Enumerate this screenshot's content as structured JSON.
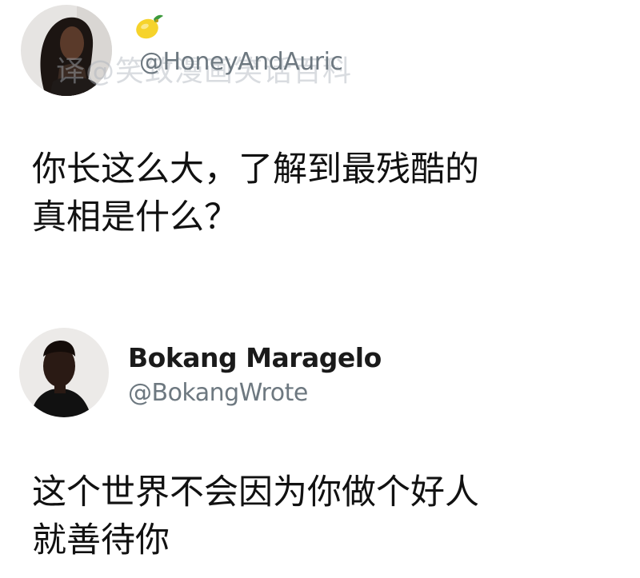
{
  "posts": [
    {
      "handle": "@HoneyAndAuric",
      "watermark": "译@笑致漫画笑话百科",
      "text": "你长这么大，了解到最残酷的\n真相是什么？",
      "avatar_icon": "woman-portrait-avatar",
      "emoji_icon": "lemon-emoji-icon"
    },
    {
      "display_name": "Bokang Maragelo",
      "handle": "@BokangWrote",
      "text": "这个世界不会因为你做个好人\n就善待你",
      "avatar_icon": "man-portrait-avatar"
    }
  ],
  "colors": {
    "text": "#111111",
    "handle": "#6d7880",
    "background": "#ffffff"
  }
}
